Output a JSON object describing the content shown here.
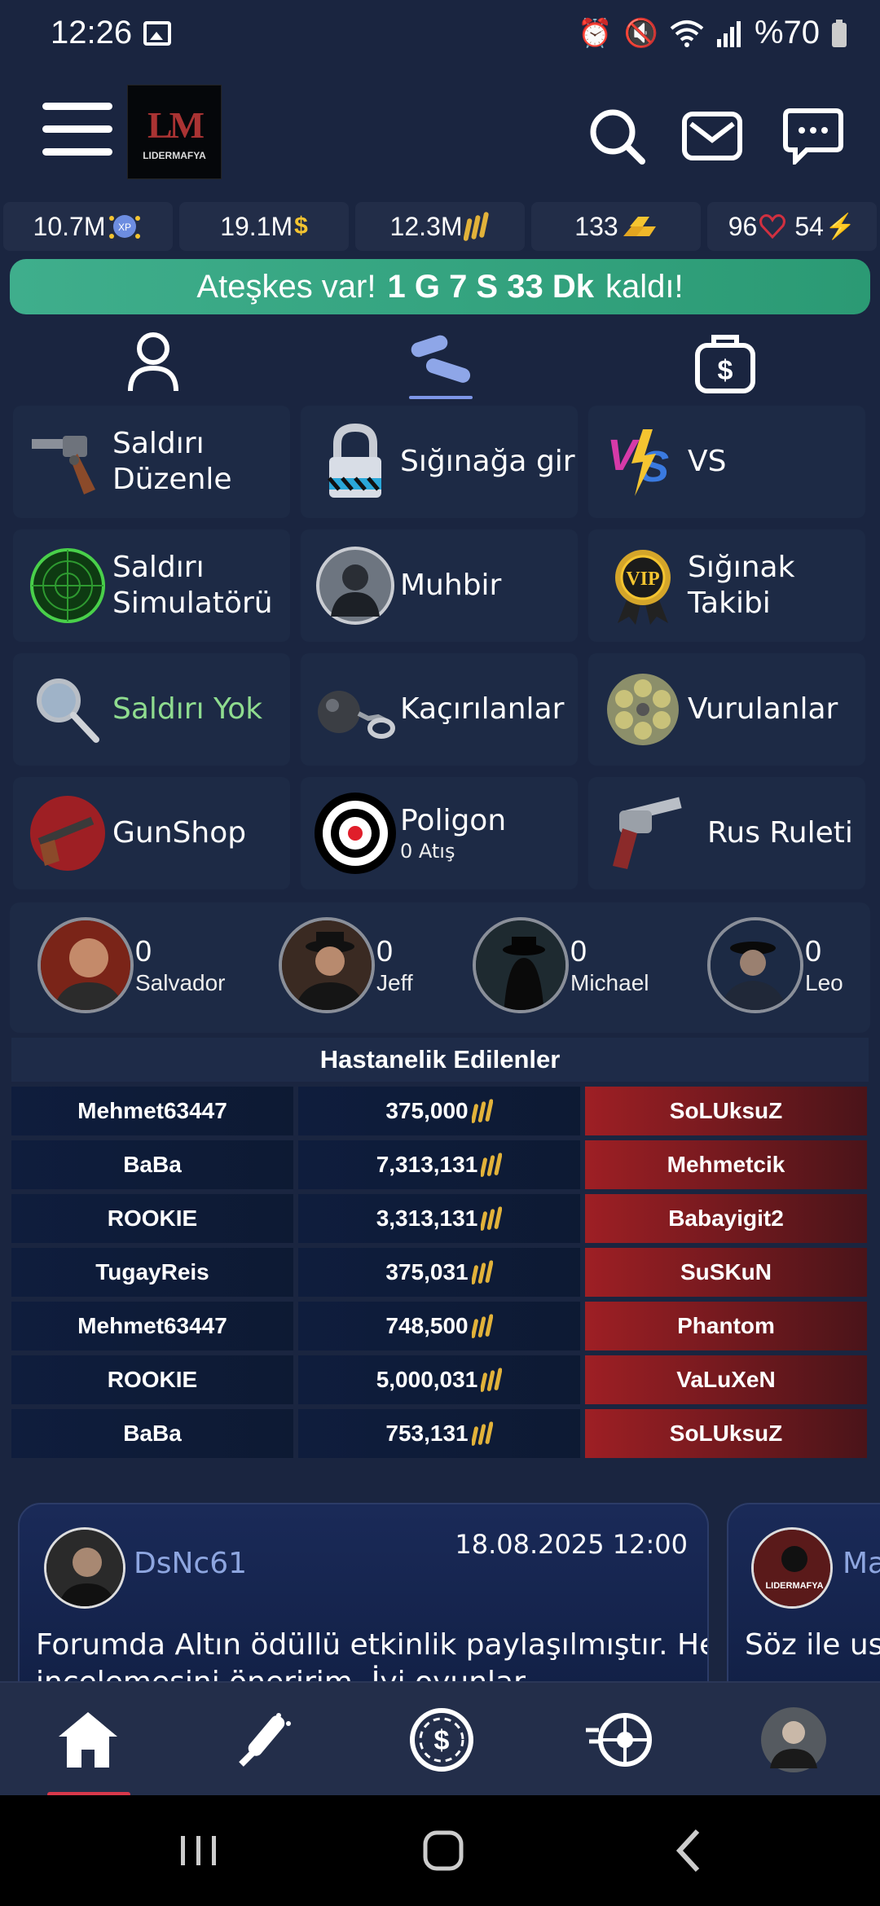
{
  "status_bar": {
    "time": "12:26",
    "battery": "%70",
    "icons": [
      "image-icon",
      "alarm-icon",
      "mute-icon",
      "wifi-icon",
      "signal-icon",
      "battery-icon"
    ]
  },
  "header": {
    "logo_text": "LIDERMAFYA",
    "buttons": [
      "menu-icon",
      "search-icon",
      "mail-icon",
      "chat-icon"
    ]
  },
  "stats": [
    {
      "value": "10.7M",
      "icon": "xp-icon"
    },
    {
      "value": "19.1M",
      "icon": "dollar-icon"
    },
    {
      "value": "12.3M",
      "icon": "bullets-icon"
    },
    {
      "value": "133",
      "icon": "gold-bars-icon"
    },
    {
      "value": "96",
      "icon": "heart-icon",
      "value2": "54",
      "icon2": "energy-icon"
    }
  ],
  "banner": {
    "prefix": "Ateşkes var!",
    "time": "1 G 7 S 33 Dk",
    "suffix": "kaldı!"
  },
  "tabs": [
    "profile-icon",
    "bullets-tab-icon",
    "money-bag-icon"
  ],
  "tiles": [
    {
      "label": "Saldırı Düzenle",
      "icon": "revolver-icon"
    },
    {
      "label": "Sığınağa gir",
      "icon": "padlock-icon"
    },
    {
      "label": "VS",
      "icon": "vs-icon"
    },
    {
      "label": "Saldırı Simulatörü",
      "icon": "radar-icon"
    },
    {
      "label": "Muhbir",
      "icon": "informant-icon"
    },
    {
      "label": "Sığınak Takibi",
      "icon": "vip-badge-icon"
    },
    {
      "label": "Saldırı Yok",
      "icon": "magnifier-icon"
    },
    {
      "label": "Kaçırılanlar",
      "icon": "ball-chain-icon"
    },
    {
      "label": "Vurulanlar",
      "icon": "cylinder-icon"
    },
    {
      "label": "GunShop",
      "icon": "gunshop-icon"
    },
    {
      "label": "Poligon",
      "sub": "0 Atış",
      "icon": "target-icon"
    },
    {
      "label": "Rus Ruleti",
      "icon": "pistol-icon"
    }
  ],
  "leaders": [
    {
      "count": "0",
      "name": "Salvador"
    },
    {
      "count": "0",
      "name": "Jeff"
    },
    {
      "count": "0",
      "name": "Michael"
    },
    {
      "count": "0",
      "name": "Leo"
    }
  ],
  "hospital": {
    "title": "Hastanelik Edilenler",
    "rows": [
      {
        "attacker": "Mehmet63447",
        "amount": "375,000",
        "victim": "SoLUksuZ"
      },
      {
        "attacker": "BaBa",
        "amount": "7,313,131",
        "victim": "Mehmetcik"
      },
      {
        "attacker": "ROOKIE",
        "amount": "3,313,131",
        "victim": "Babayigit2"
      },
      {
        "attacker": "TugayReis",
        "amount": "375,031",
        "victim": "SuSKuN"
      },
      {
        "attacker": "Mehmet63447",
        "amount": "748,500",
        "victim": "Phantom"
      },
      {
        "attacker": "ROOKIE",
        "amount": "5,000,031",
        "victim": "VaLuXeN"
      },
      {
        "attacker": "BaBa",
        "amount": "753,131",
        "victim": "SoLUksuZ"
      }
    ]
  },
  "news": [
    {
      "author": "DsNc61",
      "date": "18.08.2025 12:00",
      "line1": "Forumda Altın ödüllü etkinlik paylaşılmıştır. Herkesin",
      "line2": "incelemesini öneririm. İyi oyunlar."
    },
    {
      "author": "Ma",
      "avatar_text": "LIDERMAFYA",
      "line1": "Söz ile usla"
    }
  ],
  "bottom_nav": [
    "home-icon",
    "bat-icon",
    "casino-chip-icon",
    "racing-wheel-icon",
    "profile-avatar"
  ],
  "colors": {
    "background": "#1a2540",
    "tile": "#1d2a45",
    "banner": "#3fae8c",
    "victim_cell": "#9e1f24",
    "active_underline": "#d8384a"
  }
}
